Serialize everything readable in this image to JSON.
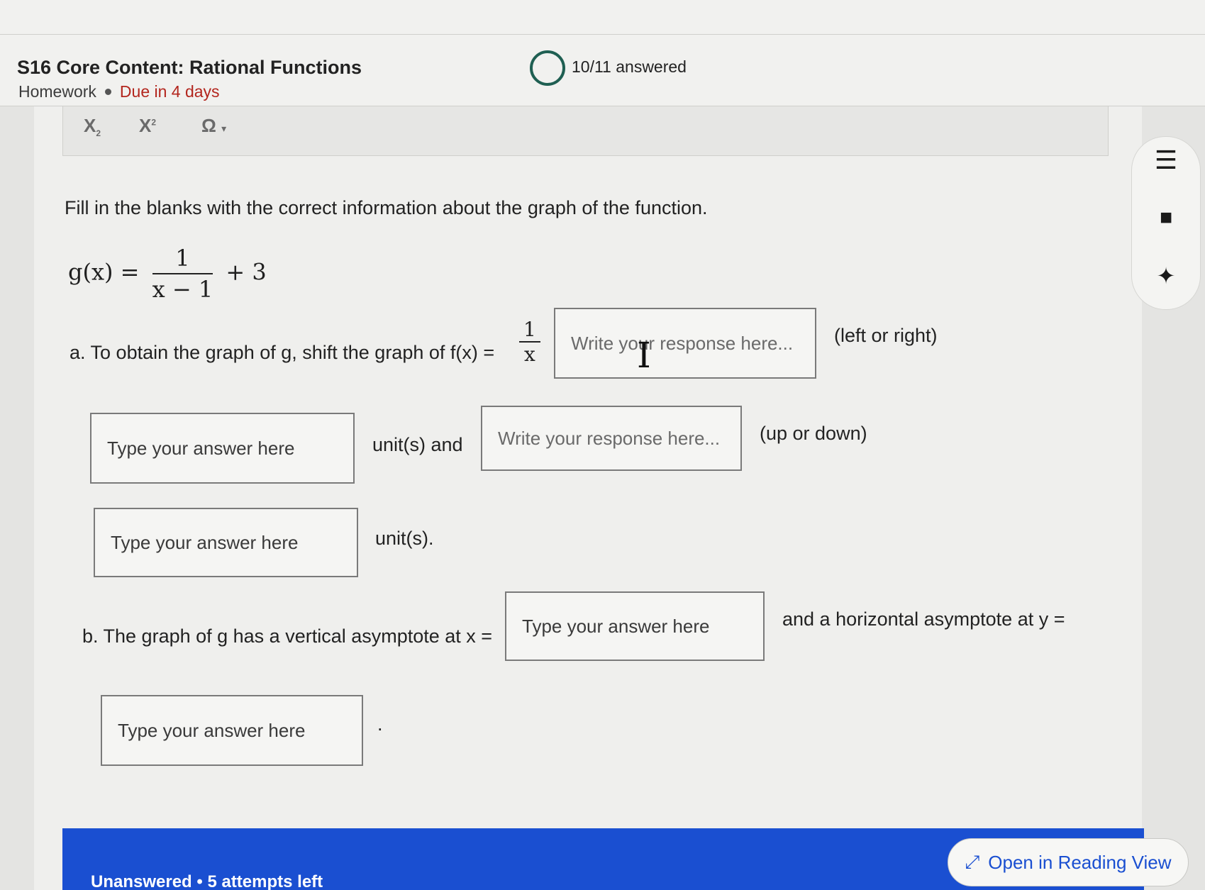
{
  "header": {
    "title": "S16 Core Content: Rational Functions",
    "type": "Homework",
    "due": "Due in 4 days",
    "progress": "10/11 answered",
    "progress_fraction": 0.909
  },
  "toolbar": {
    "subscript": "X",
    "superscript": "X",
    "omega": "Ω"
  },
  "question": {
    "prompt": "Fill in the blanks with the correct information about the graph of the function.",
    "function_lhs": "g(x) =",
    "function_num": "1",
    "function_den": "x − 1",
    "function_rhs": "+ 3",
    "part_a_text": "a. To obtain the graph of g, shift the graph of f(x) =",
    "part_a_frac_num": "1",
    "part_a_frac_den": "x",
    "left_right_hint": "(left or right)",
    "units_and": "unit(s) and",
    "up_down_hint": "(up or down)",
    "units_end": "unit(s).",
    "part_b_text": "b. The graph of g has a vertical asymptote at x =",
    "part_b_text2": "and a horizontal asymptote at y =",
    "period": "."
  },
  "inputs": {
    "write_placeholder": "Write your response here...",
    "type_placeholder": "Type your answer here"
  },
  "footer": {
    "attempts": "Unanswered • 5 attempts left",
    "reading_view": "Open in Reading View"
  }
}
